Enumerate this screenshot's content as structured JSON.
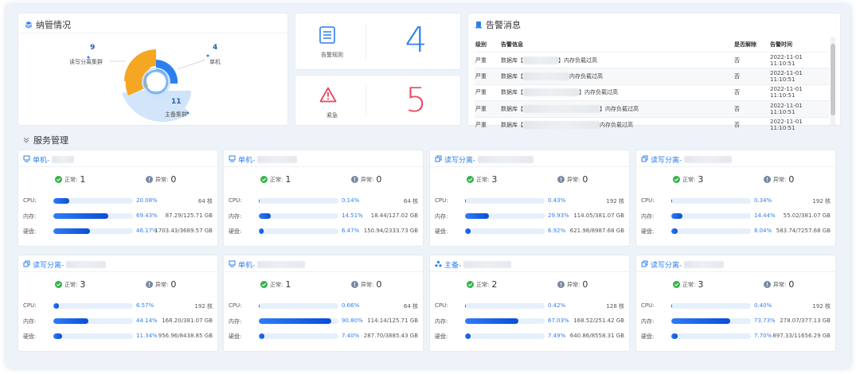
{
  "management": {
    "title": "纳管情况",
    "rw_count": "9",
    "rw_label": "读写分离集群",
    "single_count": "4",
    "single_label": "单机",
    "master_count": "11",
    "master_label": "主备集群",
    "colors": {
      "rw": "#f5a623",
      "single": "#2d7ff0",
      "master": "#cfe3fa"
    }
  },
  "stats": {
    "rules_label": "告警规则",
    "rules_count": "4",
    "rules_color": "#2d7ff0",
    "urgent_label": "紧急",
    "urgent_count": "5",
    "urgent_color": "#e8455f"
  },
  "alerts": {
    "title": "告警消息",
    "headers": {
      "level": "级别",
      "info": "告警信息",
      "resolved": "是否解除",
      "time": "告警时间"
    },
    "rows": [
      {
        "level": "严重",
        "prefix": "数据库【",
        "suffix": "】内存负载过高",
        "resolved": "否",
        "time": "2022-11-01 11:10:51"
      },
      {
        "level": "严重",
        "prefix": "数据库【",
        "suffix": "内存负载过高",
        "resolved": "否",
        "time": "2022-11-01 11:10:51"
      },
      {
        "level": "严重",
        "prefix": "数据库【",
        "suffix": "】内存负载过高",
        "resolved": "否",
        "time": "2022-11-01 11:10:51"
      },
      {
        "level": "严重",
        "prefix": "数据库【",
        "suffix": "】内存负载过高",
        "resolved": "否",
        "time": "2022-11-01 11:10:51"
      },
      {
        "level": "严重",
        "prefix": "数据库【",
        "suffix": "内存负载过高",
        "resolved": "否",
        "time": "2022-11-01 11:10:51"
      }
    ]
  },
  "services": {
    "title": "服务管理",
    "labels": {
      "normal": "正常:",
      "abnormal": "异常:",
      "cpu": "CPU:",
      "mem": "内存:",
      "disk": "硬盘:"
    },
    "cards": [
      {
        "type": "单机-",
        "icon": "server-icon",
        "normal": "1",
        "abnormal": "0",
        "cpu_pct": "20.08%",
        "cpu_val": 20.08,
        "cpu_amt": "64 核",
        "mem_pct": "69.43%",
        "mem_val": 69.43,
        "mem_amt": "87.29/125.71 GB",
        "disk_pct": "46.17%",
        "disk_val": 46.17,
        "disk_amt": "1703.43/3689.57 GB"
      },
      {
        "type": "单机-",
        "icon": "server-icon",
        "normal": "1",
        "abnormal": "0",
        "cpu_pct": "0.14%",
        "cpu_val": 0.14,
        "cpu_amt": "64 核",
        "mem_pct": "14.51%",
        "mem_val": 14.51,
        "mem_amt": "18.44/127.02 GB",
        "disk_pct": "6.47%",
        "disk_val": 6.47,
        "disk_amt": "150.94/2333.73 GB"
      },
      {
        "type": "读写分离-",
        "icon": "copy-icon",
        "normal": "3",
        "abnormal": "0",
        "cpu_pct": "0.43%",
        "cpu_val": 0.43,
        "cpu_amt": "192 核",
        "mem_pct": "29.93%",
        "mem_val": 29.93,
        "mem_amt": "114.05/381.07 GB",
        "disk_pct": "6.92%",
        "disk_val": 6.92,
        "disk_amt": "621.98/8987.68 GB"
      },
      {
        "type": "读写分离-",
        "icon": "copy-icon",
        "normal": "3",
        "abnormal": "0",
        "cpu_pct": "0.34%",
        "cpu_val": 0.34,
        "cpu_amt": "192 核",
        "mem_pct": "14.44%",
        "mem_val": 14.44,
        "mem_amt": "55.02/381.07 GB",
        "disk_pct": "8.04%",
        "disk_val": 8.04,
        "disk_amt": "583.74/7257.68 GB"
      },
      {
        "type": "读写分离-",
        "icon": "copy-icon",
        "normal": "3",
        "abnormal": "0",
        "cpu_pct": "6.57%",
        "cpu_val": 6.57,
        "cpu_amt": "192 核",
        "mem_pct": "44.14%",
        "mem_val": 44.14,
        "mem_amt": "168.20/381.07 GB",
        "disk_pct": "11.34%",
        "disk_val": 11.34,
        "disk_amt": "956.96/8438.85 GB"
      },
      {
        "type": "单机-",
        "icon": "server-icon",
        "normal": "1",
        "abnormal": "0",
        "cpu_pct": "0.66%",
        "cpu_val": 0.66,
        "cpu_amt": "64 核",
        "mem_pct": "90.80%",
        "mem_val": 90.8,
        "mem_amt": "114.14/125.71 GB",
        "disk_pct": "7.40%",
        "disk_val": 7.4,
        "disk_amt": "287.70/3885.43 GB"
      },
      {
        "type": "主备-",
        "icon": "cluster-icon",
        "normal": "2",
        "abnormal": "0",
        "cpu_pct": "0.42%",
        "cpu_val": 0.42,
        "cpu_amt": "128 核",
        "mem_pct": "67.03%",
        "mem_val": 67.03,
        "mem_amt": "168.52/251.42 GB",
        "disk_pct": "7.49%",
        "disk_val": 7.49,
        "disk_amt": "640.86/8558.31 GB"
      },
      {
        "type": "读写分离-",
        "icon": "copy-icon",
        "normal": "3",
        "abnormal": "0",
        "cpu_pct": "0.40%",
        "cpu_val": 0.4,
        "cpu_amt": "192 核",
        "mem_pct": "73.73%",
        "mem_val": 73.73,
        "mem_amt": "278.07/377.13 GB",
        "disk_pct": "7.70%",
        "disk_val": 7.7,
        "disk_amt": "897.33/11656.29 GB"
      }
    ]
  }
}
